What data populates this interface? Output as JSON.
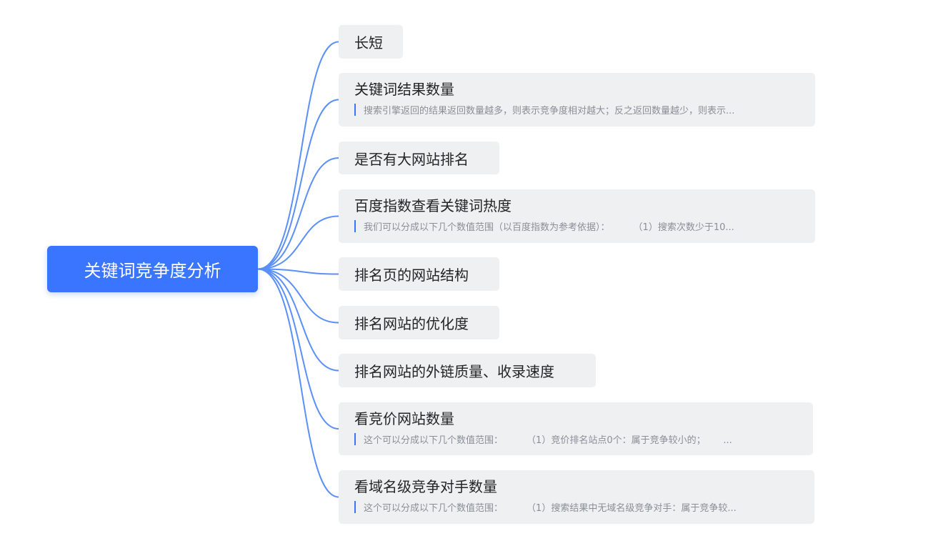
{
  "root": {
    "label": "关键词竞争度分析"
  },
  "branches": [
    {
      "title": "长短"
    },
    {
      "title": "关键词结果数量",
      "note": "搜索引擎返回的结果返回数量越多，则表示竞争度相对越大；反之返回数量越少，则表示..."
    },
    {
      "title": "是否有大网站排名"
    },
    {
      "title": "百度指数查看关键词热度",
      "note": "我们可以分成以下几个数值范围（以百度指数为参考依据）：        （1）搜索次数少于10..."
    },
    {
      "title": "排名页的网站结构"
    },
    {
      "title": "排名网站的优化度"
    },
    {
      "title": "排名网站的外链质量、收录速度"
    },
    {
      "title": "看竞价网站数量",
      "note": "这个可以分成以下几个数值范围：        （1）竞价排名站点0个：属于竞争较小的；      ..."
    },
    {
      "title": "看域名级竞争对手数量",
      "note": "这个可以分成以下几个数值范围：        （1）搜索结果中无域名级竞争对手：属于竞争较..."
    }
  ],
  "colors": {
    "root_fill": "#3a75ff",
    "branch_line": "#5b8ff9",
    "node_fill": "#eef0f2",
    "note_bar": "#3a75ff",
    "note_text": "#8a8f97"
  }
}
